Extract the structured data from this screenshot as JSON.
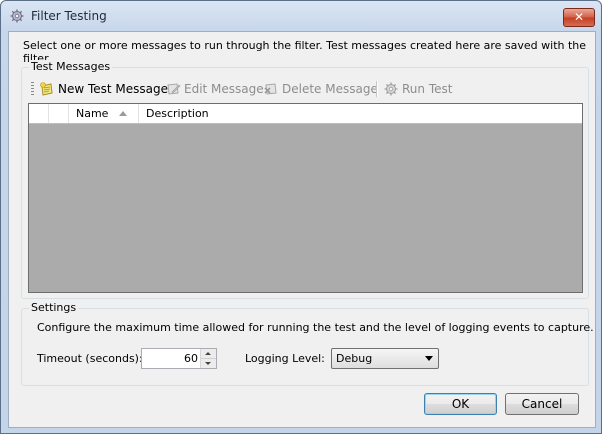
{
  "window": {
    "title": "Filter Testing",
    "close_label": "✕"
  },
  "intro_text": "Select one or more messages to run through the filter. Test messages created here are saved with the filter.",
  "test_messages": {
    "group_label": "Test Messages",
    "toolbar": {
      "new_label": "New Test Message",
      "edit_label": "Edit Message",
      "delete_label": "Delete Message",
      "run_label": "Run Test"
    },
    "columns": {
      "name": "Name",
      "description": "Description"
    },
    "rows": []
  },
  "settings": {
    "group_label": "Settings",
    "description": "Configure the maximum time allowed for running the test and the level of logging events to capture.",
    "timeout_label": "Timeout (seconds):",
    "timeout_value": "60",
    "logging_label": "Logging Level:",
    "logging_value": "Debug"
  },
  "buttons": {
    "ok": "OK",
    "cancel": "Cancel"
  }
}
